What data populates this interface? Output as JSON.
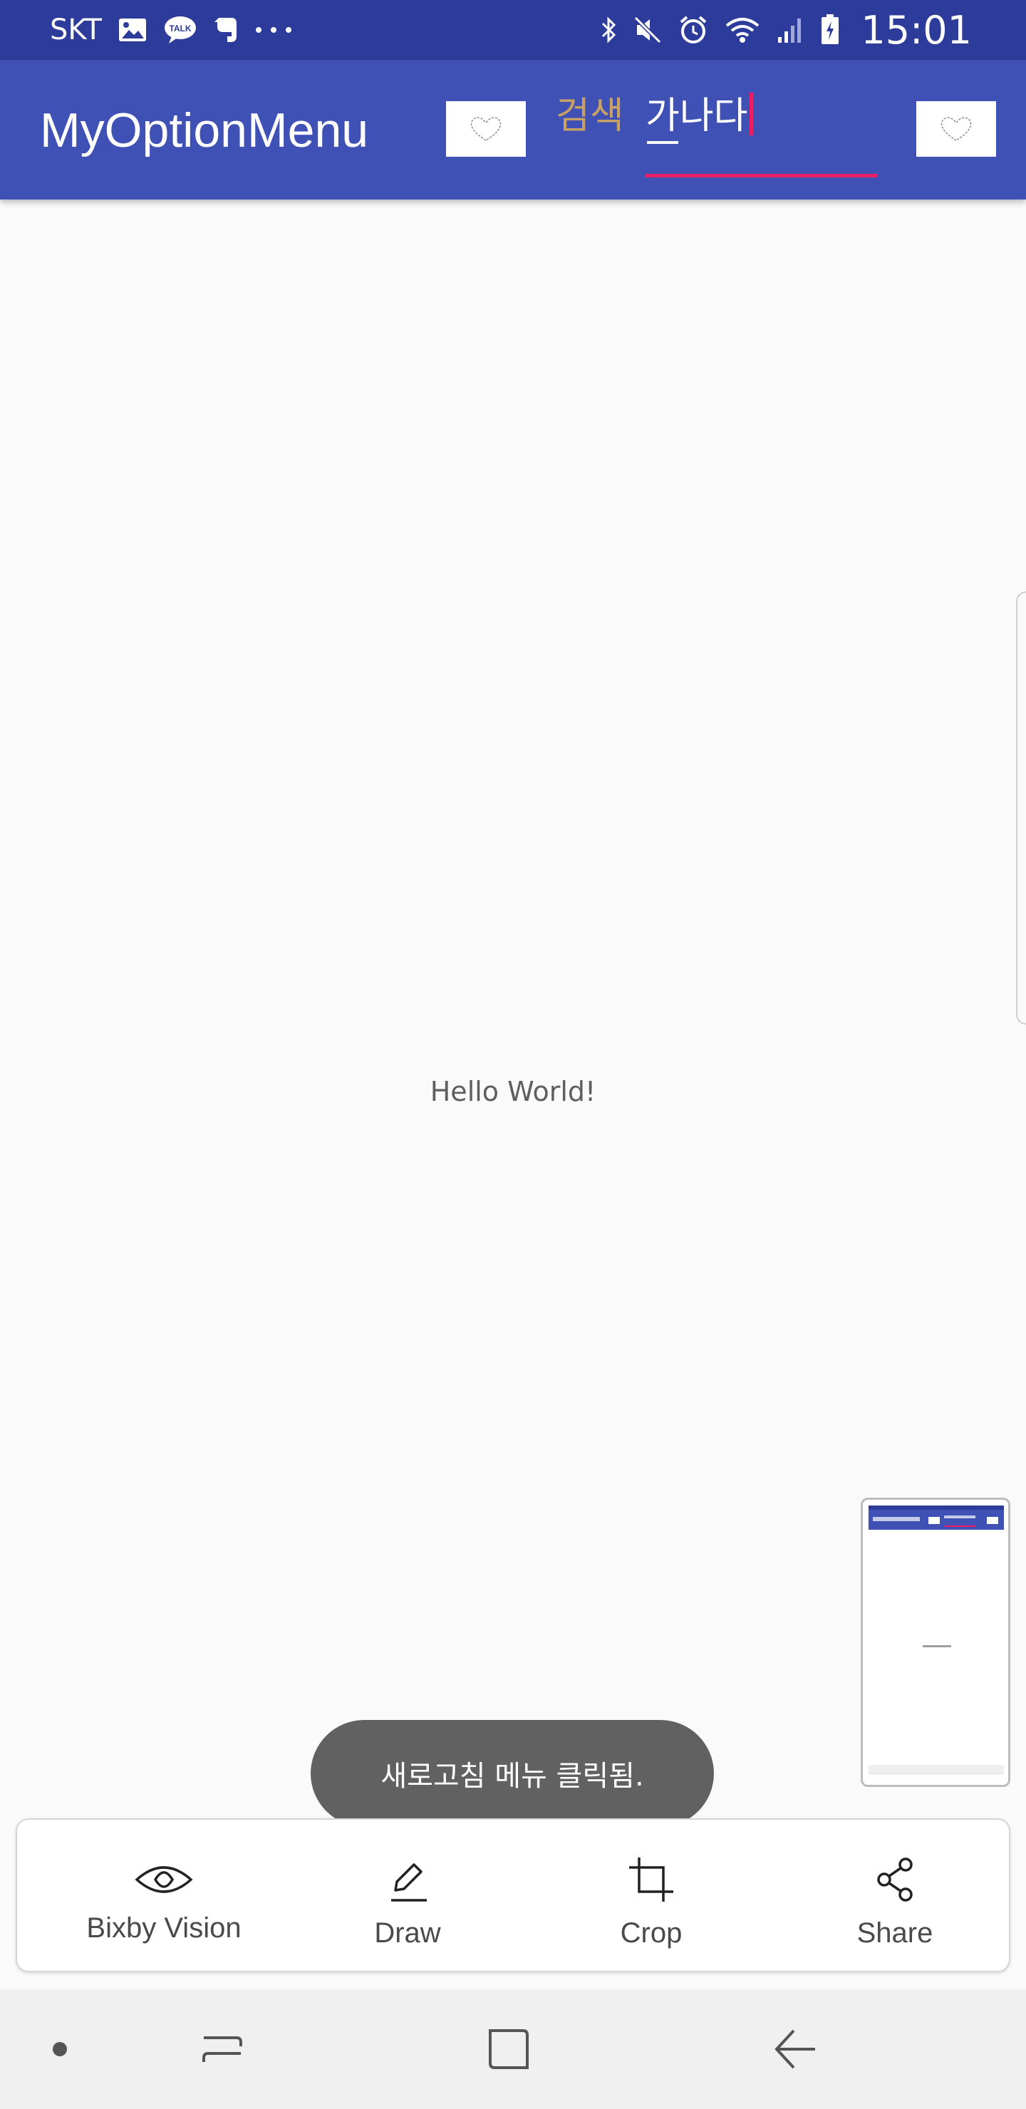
{
  "status_bar": {
    "carrier": "SKT",
    "time": "15:01",
    "left_icons": [
      "gallery-icon",
      "kakaotalk-icon",
      "evernote-icon",
      "more-notifications-icon"
    ],
    "right_icons": [
      "bluetooth-icon",
      "mute-icon",
      "alarm-icon",
      "wifi-icon",
      "signal-icon",
      "battery-charging-icon"
    ]
  },
  "app_bar": {
    "title": "MyOptionMenu",
    "search_label": "검색",
    "search_value": "가나다"
  },
  "content": {
    "hello_text": "Hello World!"
  },
  "toast": {
    "message": "새로고침 메뉴 클릭됨."
  },
  "capture_menu": {
    "items": [
      {
        "label": "Bixby Vision",
        "icon": "eye-icon"
      },
      {
        "label": "Draw",
        "icon": "pencil-icon"
      },
      {
        "label": "Crop",
        "icon": "crop-icon"
      },
      {
        "label": "Share",
        "icon": "share-icon"
      }
    ]
  },
  "nav_bar": {
    "buttons": [
      "dot-button",
      "recents-button",
      "home-button",
      "back-button"
    ]
  },
  "colors": {
    "status_bar": "#2d3c9a",
    "app_bar": "#3f51b5",
    "accent": "#e91e63",
    "search_label": "#c9a064",
    "toast": "#616161"
  }
}
